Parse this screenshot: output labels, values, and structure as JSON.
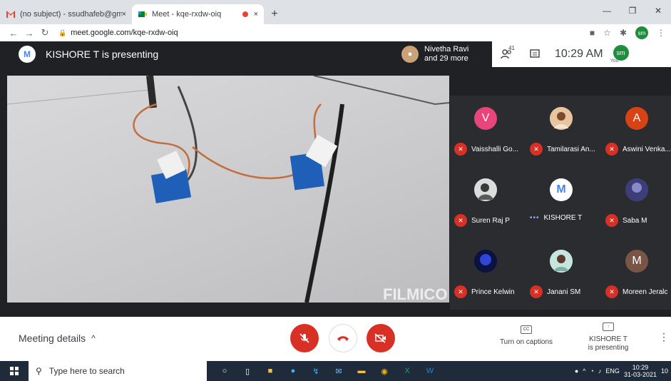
{
  "browser": {
    "tabs": [
      {
        "title": "(no subject) - ssudhafeb@gmail.",
        "close": "×"
      },
      {
        "title": "Meet - kqe-rxdw-oiq",
        "close": "×"
      }
    ],
    "new_tab": "+",
    "window_controls": {
      "minimize": "—",
      "maximize": "❐",
      "close": "✕"
    },
    "url": "meet.google.com/kqe-rxdw-oiq",
    "profile": "sm"
  },
  "meet": {
    "presenting_title": "KISHORE T is presenting",
    "participants_info": {
      "line1": "Nivetha Ravi",
      "line2": "and 29 more"
    },
    "people_count": "41",
    "time": "10:29 AM",
    "self": {
      "initials": "sm",
      "label": "You"
    },
    "video_watermark": "FILMICO",
    "tiles": [
      {
        "name": "Vaisshalli Go...",
        "initial": "V",
        "color": "#e8457a",
        "state": "muted"
      },
      {
        "name": "Tamilarasi An...",
        "initial": "",
        "color": "#d9a37a",
        "state": "muted"
      },
      {
        "name": "Aswini Venka...",
        "initial": "A",
        "color": "#d84315",
        "state": "muted"
      },
      {
        "name": "Suren Raj P",
        "initial": "",
        "color": "#6d6d6d",
        "state": "muted"
      },
      {
        "name": "KISHORE T",
        "initial": "",
        "color": "#ffffff",
        "state": "speaking"
      },
      {
        "name": "Saba M",
        "initial": "",
        "color": "#5b5b9a",
        "state": "muted"
      },
      {
        "name": "Prince Kelwin",
        "initial": "",
        "color": "#1b2a7a",
        "state": "muted"
      },
      {
        "name": "Janani SM",
        "initial": "",
        "color": "#9cc5c0",
        "state": "muted"
      },
      {
        "name": "Moreen Jeralc",
        "initial": "M",
        "color": "#795548",
        "state": "muted"
      }
    ],
    "bottom": {
      "meeting_details": "Meeting details",
      "captions": "Turn on captions",
      "captions_icon": "CC",
      "present_line1": "KISHORE T",
      "present_line2": "is presenting"
    }
  },
  "taskbar": {
    "search_placeholder": "Type here to search",
    "lang": "ENG",
    "clock_time": "10:29",
    "clock_date": "31-03-2021",
    "notif": "10"
  }
}
